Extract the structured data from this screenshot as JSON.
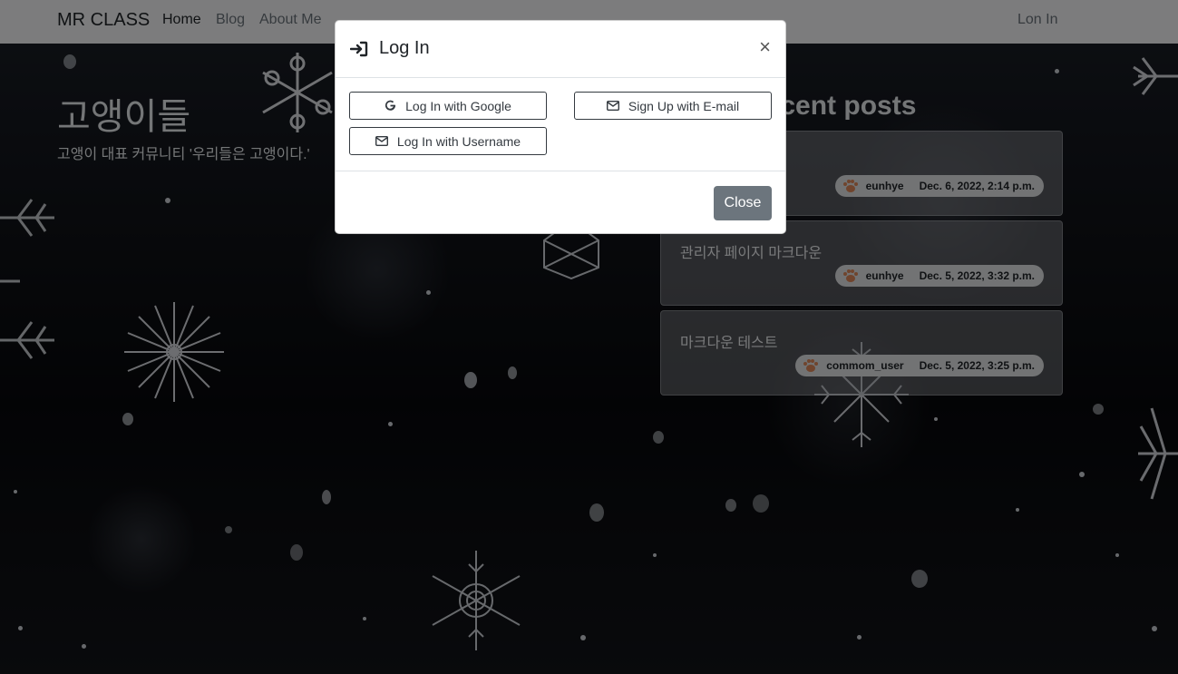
{
  "navbar": {
    "brand": "MR CLASS",
    "links": [
      "Home",
      "Blog",
      "About Me"
    ],
    "login": "Lon In"
  },
  "hero": {
    "title": "고앵이들",
    "subtitle": "고앵이 대표 커뮤니티 '우리들은 고앵이다.'"
  },
  "recent": {
    "title": "Recent posts",
    "posts": [
      {
        "title": "",
        "author": "eunhye",
        "date": "Dec. 6, 2022, 2:14 p.m."
      },
      {
        "title": "관리자 페이지 마크다운",
        "author": "eunhye",
        "date": "Dec. 5, 2022, 3:32 p.m."
      },
      {
        "title": "마크다운 테스트",
        "author": "commom_user",
        "date": "Dec. 5, 2022, 3:25 p.m."
      }
    ]
  },
  "modal": {
    "title": "Log In",
    "close_symbol": "×",
    "google_button": "Log In with Google",
    "username_button": "Log In with Username",
    "signup_button": "Sign Up with E-mail",
    "close_button": "Close"
  },
  "colors": {
    "navbar_bg": "#f8f9fa",
    "close_button": "#6c757d",
    "author_badge_icon": "#e0895a"
  },
  "icons": {
    "login": "sign-in-icon",
    "google": "google-icon",
    "email": "envelope-icon",
    "paw": "paw-icon",
    "close": "close-icon"
  }
}
